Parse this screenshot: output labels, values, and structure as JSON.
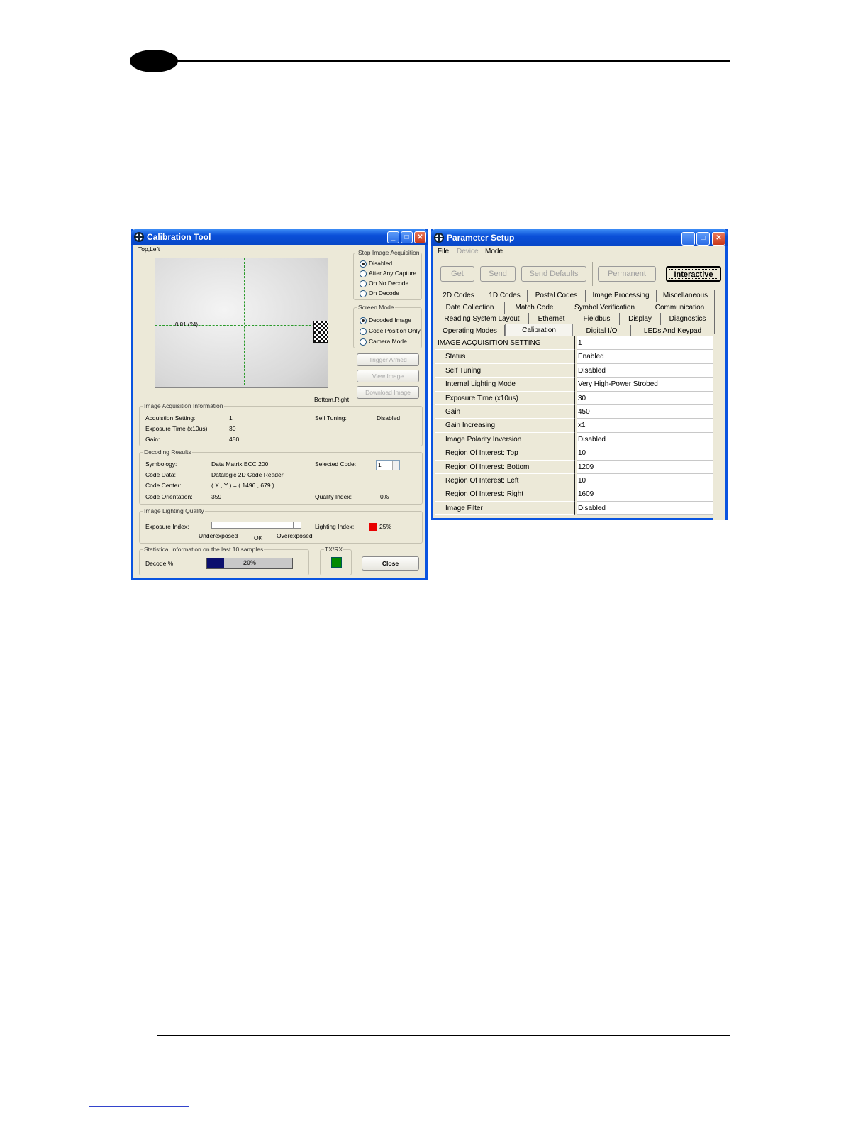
{
  "calibration_tool": {
    "title": "Calibration Tool",
    "top_left_label": "Top,Left",
    "bottom_right_label": "Bottom,Right",
    "crosshair_label": "0.81 (24)",
    "stop_image_acquisition": {
      "title": "Stop Image Acquisition",
      "options": [
        "Disabled",
        "After Any Capture",
        "On No Decode",
        "On Decode"
      ],
      "selected": "Disabled"
    },
    "screen_mode": {
      "title": "Screen Mode",
      "options": [
        "Decoded Image",
        "Code Position Only",
        "Camera Mode"
      ],
      "selected": "Decoded Image"
    },
    "buttons": {
      "trigger_armed": "Trigger Armed",
      "view_image": "View Image",
      "download_image": "Download Image",
      "close": "Close"
    },
    "image_acquisition_information": {
      "title": "Image Acquisition Information",
      "acquisition_setting_label": "Acquistion Setting:",
      "acquisition_setting_value": "1",
      "self_tuning_label": "Self Tuning:",
      "self_tuning_value": "Disabled",
      "exposure_time_label": "Exposure Time (x10us):",
      "exposure_time_value": "30",
      "gain_label": "Gain:",
      "gain_value": "450"
    },
    "decoding_results": {
      "title": "Decoding Results",
      "symbology_label": "Symbology:",
      "symbology_value": "Data Matrix ECC 200",
      "selected_code_label": "Selected Code:",
      "selected_code_value": "1",
      "code_data_label": "Code Data:",
      "code_data_value": "Datalogic 2D Code Reader",
      "code_center_label": "Code Center:",
      "code_center_value": "( X , Y ) = ( 1496 , 679 )",
      "code_orientation_label": "Code Orientation:",
      "code_orientation_value": "359",
      "quality_index_label": "Quality Index:",
      "quality_index_value": "0%"
    },
    "image_lighting_quality": {
      "title": "Image Lighting Quality",
      "exposure_index_label": "Exposure Index:",
      "underexposed": "Underexposed",
      "ok": "OK",
      "overexposed": "Overexposed",
      "lighting_index_label": "Lighting Index:",
      "lighting_index_value": "25%",
      "lighting_color": "#e80000"
    },
    "statistics": {
      "title": "Statistical information on the last 10 samples",
      "decode_label": "Decode %:",
      "decode_value": "20%",
      "decode_fraction": 0.2
    },
    "txrx": {
      "title": "TX/RX",
      "color": "#008a00"
    }
  },
  "parameter_setup": {
    "title": "Parameter Setup",
    "menu": [
      "File",
      "Device",
      "Mode"
    ],
    "toolbar": {
      "get": "Get",
      "send": "Send",
      "send_defaults": "Send Defaults",
      "permanent": "Permanent",
      "interactive": "Interactive"
    },
    "tabs": [
      [
        "2D Codes",
        "1D Codes",
        "Postal Codes",
        "Image Processing",
        "Miscellaneous"
      ],
      [
        "Data Collection",
        "Match Code",
        "Symbol Verification",
        "Communication"
      ],
      [
        "Reading System Layout",
        "Ethernet",
        "Fieldbus",
        "Display",
        "Diagnostics"
      ],
      [
        "Operating Modes",
        "Calibration",
        "Digital I/O",
        "LEDs And Keypad"
      ]
    ],
    "selected_tab": "Calibration",
    "grid": [
      {
        "key": "IMAGE ACQUISITION SETTING",
        "value": "1"
      },
      {
        "key": "Status",
        "value": "Enabled"
      },
      {
        "key": "Self Tuning",
        "value": "Disabled"
      },
      {
        "key": "Internal Lighting Mode",
        "value": "Very High-Power Strobed"
      },
      {
        "key": "Exposure Time (x10us)",
        "value": "30"
      },
      {
        "key": "Gain",
        "value": "450"
      },
      {
        "key": "Gain Increasing",
        "value": "x1"
      },
      {
        "key": "Image Polarity Inversion",
        "value": "Disabled"
      },
      {
        "key": "Region Of Interest: Top",
        "value": "10"
      },
      {
        "key": "Region Of Interest: Bottom",
        "value": "1209"
      },
      {
        "key": "Region Of Interest: Left",
        "value": "10"
      },
      {
        "key": "Region Of Interest: Right",
        "value": "1609"
      },
      {
        "key": "Image Filter",
        "value": "Disabled"
      }
    ]
  }
}
